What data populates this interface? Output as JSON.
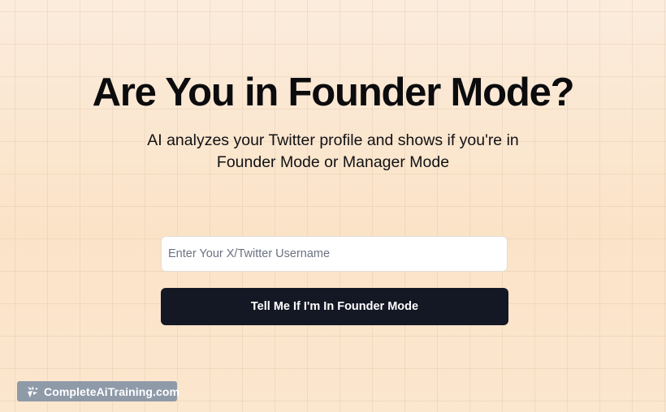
{
  "hero": {
    "title": "Are You in Founder Mode?",
    "subtitle_line1": "AI analyzes your Twitter profile and shows if you're in",
    "subtitle_line2": "Founder Mode or Manager Mode"
  },
  "form": {
    "username_value": "",
    "username_placeholder": "Enter Your X/Twitter Username",
    "submit_label": "Tell Me If I'm In Founder Mode"
  },
  "watermark": {
    "icon": "sparkle-logo-icon",
    "label": "CompleteAiTraining.com"
  },
  "colors": {
    "background": "#fbe9d6",
    "button": "#141824",
    "watermark_bg": "#8f9aa9"
  }
}
